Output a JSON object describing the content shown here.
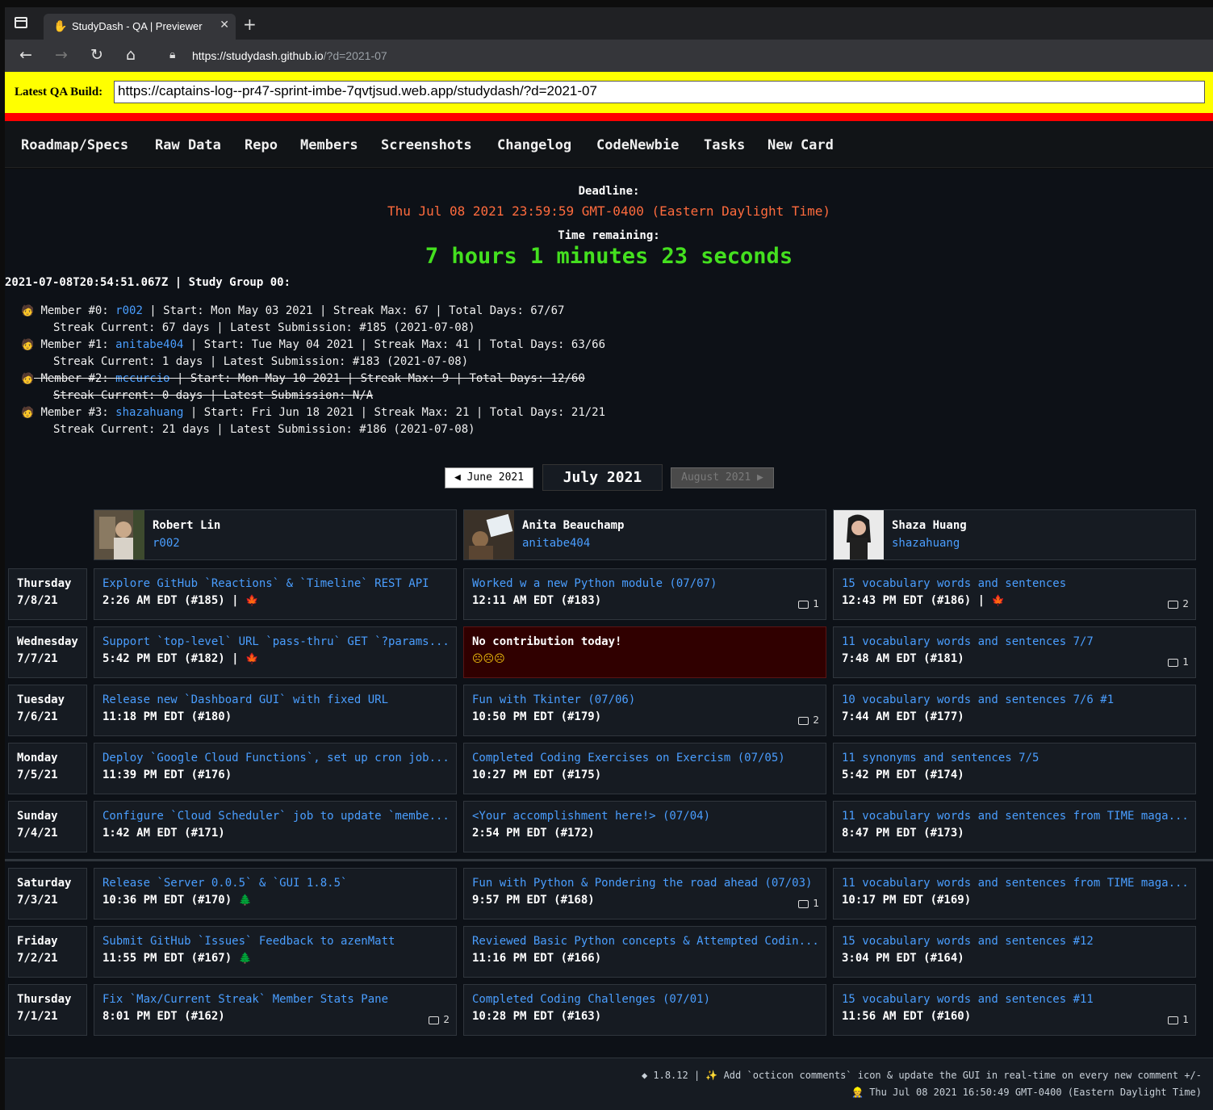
{
  "browser": {
    "tab_title": "StudyDash - QA | Previewer",
    "url_host": "https://studydash.github.io",
    "url_rest": "/?d=2021-07"
  },
  "qa": {
    "label": "Latest QA Build:",
    "value": "https://captains-log--pr47-sprint-imbe-7qvtjsud.web.app/studydash/?d=2021-07"
  },
  "nav": [
    "Roadmap/Specs",
    "Raw Data",
    "Repo",
    "Members",
    "Screenshots",
    "Changelog",
    "CodeNewbie",
    "Tasks",
    "New Card"
  ],
  "deadline": {
    "label": "Deadline:",
    "date": "Thu Jul 08 2021 23:59:59 GMT-0400 (Eastern Daylight Time)",
    "remaining_label": "Time remaining:",
    "remaining": "7 hours 1 minutes 23 seconds"
  },
  "group_header": "2021-07-08T20:54:51.067Z | Study Group 00:",
  "members": [
    {
      "prefix": "Member #0: ",
      "handle": "r002",
      "rest": " | Start: Mon May 03 2021 | Streak Max: 67 | Total Days: 67/67",
      "line2": "Streak Current: 67 days | Latest Submission: #185 (2021-07-08)"
    },
    {
      "prefix": "Member #1: ",
      "handle": "anitabe404",
      "rest": " | Start: Tue May 04 2021 | Streak Max: 41 | Total Days: 63/66",
      "line2": "Streak Current: 1 days | Latest Submission: #183 (2021-07-08)"
    },
    {
      "prefix": "Member #2: ",
      "handle": "mccurcio",
      "rest": " | Start: Mon May 10 2021 | Streak Max: 9 | Total Days: 12/60",
      "line2": "Streak Current: 0 days | Latest Submission: N/A"
    },
    {
      "prefix": "Member #3: ",
      "handle": "shazahuang",
      "rest": " | Start: Fri Jun 18 2021 | Streak Max: 21 | Total Days: 21/21",
      "line2": "Streak Current: 21 days | Latest Submission: #186 (2021-07-08)"
    }
  ],
  "month": {
    "prev": "◀ June 2021",
    "current": "July 2021",
    "next": "August 2021 ▶"
  },
  "cards": [
    {
      "name": "Robert Lin",
      "handle": "r002"
    },
    {
      "name": "Anita Beauchamp",
      "handle": "anitabe404"
    },
    {
      "name": "Shaza Huang",
      "handle": "shazahuang"
    }
  ],
  "days": [
    {
      "day": "Thursday",
      "date": "7/8/21",
      "cells": [
        {
          "title": "Explore GitHub `Reactions` & `Timeline` REST API",
          "meta": "2:26 AM EDT (#185) | ",
          "icon": "fire",
          "comments": ""
        },
        {
          "title": "Worked w a new Python module (07/07)",
          "meta": "12:11 AM EDT (#183)",
          "icon": "",
          "comments": "1"
        },
        {
          "title": "15 vocabulary words and sentences",
          "meta": "12:43 PM EDT (#186) | ",
          "icon": "fire",
          "comments": "2"
        }
      ]
    },
    {
      "day": "Wednesday",
      "date": "7/7/21",
      "cells": [
        {
          "title": "Support `top-level` URL `pass-thru` GET `?params...",
          "meta": "5:42 PM EDT (#182) | ",
          "icon": "fire",
          "comments": ""
        },
        {
          "title": "No contribution today!",
          "meta": "",
          "icon": "sad",
          "comments": "",
          "miss": true
        },
        {
          "title": "11 vocabulary words and sentences 7/7",
          "meta": "7:48 AM EDT (#181)",
          "icon": "",
          "comments": "1"
        }
      ]
    },
    {
      "day": "Tuesday",
      "date": "7/6/21",
      "cells": [
        {
          "title": "Release new `Dashboard GUI` with fixed URL",
          "meta": "11:18 PM EDT (#180)",
          "icon": "",
          "comments": ""
        },
        {
          "title": "Fun with Tkinter (07/06)",
          "meta": "10:50 PM EDT (#179)",
          "icon": "",
          "comments": "2"
        },
        {
          "title": "10 vocabulary words and sentences 7/6 #1",
          "meta": "7:44 AM EDT (#177)",
          "icon": "",
          "comments": ""
        }
      ]
    },
    {
      "day": "Monday",
      "date": "7/5/21",
      "cells": [
        {
          "title": "Deploy `Google Cloud Functions`, set up cron job...",
          "meta": "11:39 PM EDT (#176)",
          "icon": "",
          "comments": ""
        },
        {
          "title": "Completed Coding Exercises on Exercism (07/05)",
          "meta": "10:27 PM EDT (#175)",
          "icon": "",
          "comments": ""
        },
        {
          "title": "11 synonyms and sentences 7/5",
          "meta": "5:42 PM EDT (#174)",
          "icon": "",
          "comments": ""
        }
      ]
    },
    {
      "day": "Sunday",
      "date": "7/4/21",
      "cells": [
        {
          "title": "Configure `Cloud Scheduler` job to update `membe...",
          "meta": "1:42 AM EDT (#171)",
          "icon": "",
          "comments": ""
        },
        {
          "title": "<Your accomplishment here!> (07/04)",
          "meta": "2:54 PM EDT (#172)",
          "icon": "",
          "comments": ""
        },
        {
          "title": "11 vocabulary words and sentences from TIME maga...",
          "meta": "8:47 PM EDT (#173)",
          "icon": "",
          "comments": ""
        }
      ]
    },
    {
      "day": "Saturday",
      "date": "7/3/21",
      "cells": [
        {
          "title": "Release `Server 0.0.5` & `GUI 1.8.5`",
          "meta": "10:36 PM EDT (#170) ",
          "icon": "tree",
          "comments": ""
        },
        {
          "title": "Fun with Python & Pondering the road ahead (07/03)",
          "meta": "9:57 PM EDT (#168)",
          "icon": "",
          "comments": "1"
        },
        {
          "title": "11 vocabulary words and sentences from TIME maga...",
          "meta": "10:17 PM EDT (#169)",
          "icon": "",
          "comments": ""
        }
      ]
    },
    {
      "day": "Friday",
      "date": "7/2/21",
      "cells": [
        {
          "title": "Submit GitHub `Issues` Feedback to azenMatt",
          "meta": "11:55 PM EDT (#167) ",
          "icon": "tree",
          "comments": ""
        },
        {
          "title": "Reviewed Basic Python concepts & Attempted Codin...",
          "meta": "11:16 PM EDT (#166)",
          "icon": "",
          "comments": ""
        },
        {
          "title": "15 vocabulary words and sentences #12",
          "meta": "3:04 PM EDT (#164)",
          "icon": "",
          "comments": ""
        }
      ]
    },
    {
      "day": "Thursday",
      "date": "7/1/21",
      "cells": [
        {
          "title": "Fix `Max/Current Streak` Member Stats Pane",
          "meta": "8:01 PM EDT (#162)",
          "icon": "",
          "comments": "2"
        },
        {
          "title": "Completed Coding Challenges (07/01)",
          "meta": "10:28 PM EDT (#163)",
          "icon": "",
          "comments": ""
        },
        {
          "title": "15 vocabulary words and sentences #11",
          "meta": "11:56 AM EDT (#160)",
          "icon": "",
          "comments": "1"
        }
      ]
    }
  ],
  "footer": {
    "line1": "◆ 1.8.12 | ✨ Add `octicon comments` icon & update the GUI in real-time on every new comment +/-",
    "line2": "👷 Thu Jul 08 2021 16:50:49 GMT-0400 (Eastern Daylight Time)"
  },
  "colors": {
    "accent_link": "#4a9eff",
    "deadline": "#ff6b3d",
    "remaining": "#44e01f",
    "miss_bg": "#300000",
    "qa_bg": "#ffff00",
    "qa_border": "#ff0000"
  }
}
